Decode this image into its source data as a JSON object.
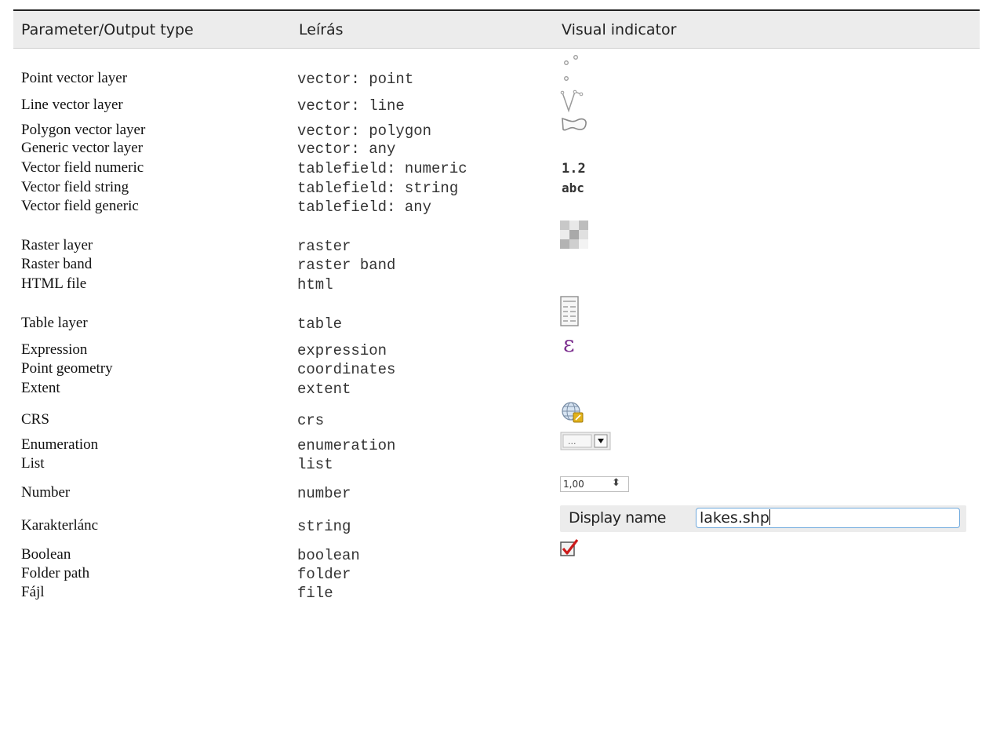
{
  "header": {
    "col1": "Parameter/Output type",
    "col2": "Leírás",
    "col3": "Visual indicator"
  },
  "rows": [
    {
      "type": "Point vector layer",
      "desc": "vector: point",
      "indicator": "point-vector-icon"
    },
    {
      "type": "Line vector layer",
      "desc": "vector: line",
      "indicator": "line-vector-icon"
    },
    {
      "type": "Polygon vector layer",
      "desc": "vector: polygon",
      "indicator": "polygon-vector-icon"
    },
    {
      "type": "Generic vector layer",
      "desc": "vector: any",
      "indicator": ""
    },
    {
      "type": "Vector field numeric",
      "desc": "tablefield: numeric",
      "indicator": "1.2"
    },
    {
      "type": "Vector field string",
      "desc": "tablefield: string",
      "indicator": "abc"
    },
    {
      "type": "Vector field generic",
      "desc": "tablefield: any",
      "indicator": ""
    },
    {
      "type": "Raster layer",
      "desc": "raster",
      "indicator": "raster-icon"
    },
    {
      "type": "Raster band",
      "desc": "raster band",
      "indicator": ""
    },
    {
      "type": "HTML file",
      "desc": "html",
      "indicator": ""
    },
    {
      "type": "Table layer",
      "desc": "table",
      "indicator": "table-icon"
    },
    {
      "type": "Expression",
      "desc": "expression",
      "indicator": "expression-icon"
    },
    {
      "type": "Point geometry",
      "desc": "coordinates",
      "indicator": ""
    },
    {
      "type": "Extent",
      "desc": "extent",
      "indicator": ""
    },
    {
      "type": "CRS",
      "desc": "crs",
      "indicator": "crs-globe-icon"
    },
    {
      "type": "Enumeration",
      "desc": "enumeration",
      "indicator": "enumeration-combobox-icon",
      "combo_text": "..."
    },
    {
      "type": "List",
      "desc": "list",
      "indicator": ""
    },
    {
      "type": "Number",
      "desc": "number",
      "indicator": "number-spinbox",
      "spin_value": "1,00"
    },
    {
      "type": "Karakterlánc",
      "desc": "string",
      "indicator": "string-field",
      "field_label": "Display name",
      "field_value": "lakes.shp"
    },
    {
      "type": "Boolean",
      "desc": "boolean",
      "indicator": "checkbox-checked-icon"
    },
    {
      "type": "Folder path",
      "desc": "folder",
      "indicator": ""
    },
    {
      "type": "Fájl",
      "desc": "file",
      "indicator": ""
    }
  ],
  "colors": {
    "header_bg": "#ececec",
    "input_focus_border": "#6fa9dd",
    "expression_purple": "#7b2d8e",
    "crs_badge": "#e2b21a",
    "check_red": "#cc1a1a"
  }
}
